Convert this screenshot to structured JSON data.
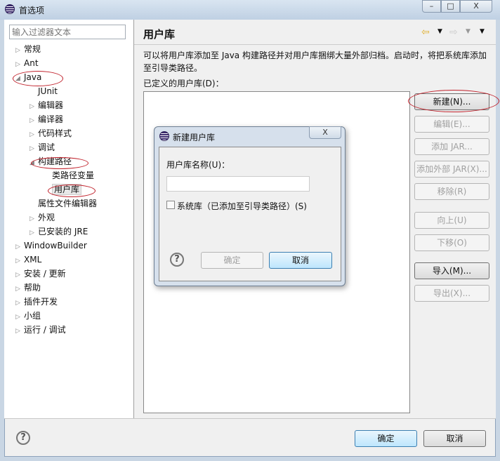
{
  "window": {
    "title": "首选项",
    "minimize": "–",
    "maximize": "□",
    "close": "X"
  },
  "filter": {
    "placeholder": "输入过滤器文本"
  },
  "tree": [
    {
      "label": "常规",
      "level": 0,
      "arrow": "▷"
    },
    {
      "label": "Ant",
      "level": 0,
      "arrow": "▷"
    },
    {
      "label": "Java",
      "level": 0,
      "arrow": "◢"
    },
    {
      "label": "JUnit",
      "level": 1,
      "arrow": ""
    },
    {
      "label": "编辑器",
      "level": 1,
      "arrow": "▷"
    },
    {
      "label": "编译器",
      "level": 1,
      "arrow": "▷"
    },
    {
      "label": "代码样式",
      "level": 1,
      "arrow": "▷"
    },
    {
      "label": "调试",
      "level": 1,
      "arrow": "▷"
    },
    {
      "label": "构建路径",
      "level": 1,
      "arrow": "◢"
    },
    {
      "label": "类路径变量",
      "level": 2,
      "arrow": ""
    },
    {
      "label": "用户库",
      "level": 2,
      "arrow": "",
      "selected": true
    },
    {
      "label": "属性文件编辑器",
      "level": 1,
      "arrow": ""
    },
    {
      "label": "外观",
      "level": 1,
      "arrow": "▷"
    },
    {
      "label": "已安装的 JRE",
      "level": 1,
      "arrow": "▷"
    },
    {
      "label": "WindowBuilder",
      "level": 0,
      "arrow": "▷"
    },
    {
      "label": "XML",
      "level": 0,
      "arrow": "▷"
    },
    {
      "label": "安装 / 更新",
      "level": 0,
      "arrow": "▷"
    },
    {
      "label": "帮助",
      "level": 0,
      "arrow": "▷"
    },
    {
      "label": "插件开发",
      "level": 0,
      "arrow": "▷"
    },
    {
      "label": "小组",
      "level": 0,
      "arrow": "▷"
    },
    {
      "label": "运行 / 调试",
      "level": 0,
      "arrow": "▷"
    }
  ],
  "page": {
    "title": "用户库",
    "description": "可以将用户库添加至 Java 构建路径并对用户库捆绑大量外部归档。启动时，将把系统库添加至引导类路径。",
    "list_label": "已定义的用户库(D)："
  },
  "buttons": [
    {
      "label": "新建(N)...",
      "enabled": true
    },
    {
      "label": "编辑(E)...",
      "enabled": false
    },
    {
      "label": "添加 JAR...",
      "enabled": false
    },
    {
      "label": "添加外部 JAR(X)...",
      "enabled": false
    },
    {
      "label": "移除(R)",
      "enabled": false
    },
    {
      "label": "向上(U)",
      "enabled": false
    },
    {
      "label": "下移(O)",
      "enabled": false
    },
    {
      "label": "导入(M)...",
      "enabled": true
    },
    {
      "label": "导出(X)...",
      "enabled": false
    }
  ],
  "footer": {
    "ok": "确定",
    "cancel": "取消",
    "help": "?"
  },
  "dialog": {
    "title": "新建用户库",
    "close": "X",
    "name_label": "用户库名称(U)：",
    "name_value": "",
    "checkbox_label": "系统库（已添加至引导类路径）(S)",
    "ok": "确定",
    "cancel": "取消",
    "help": "?"
  }
}
